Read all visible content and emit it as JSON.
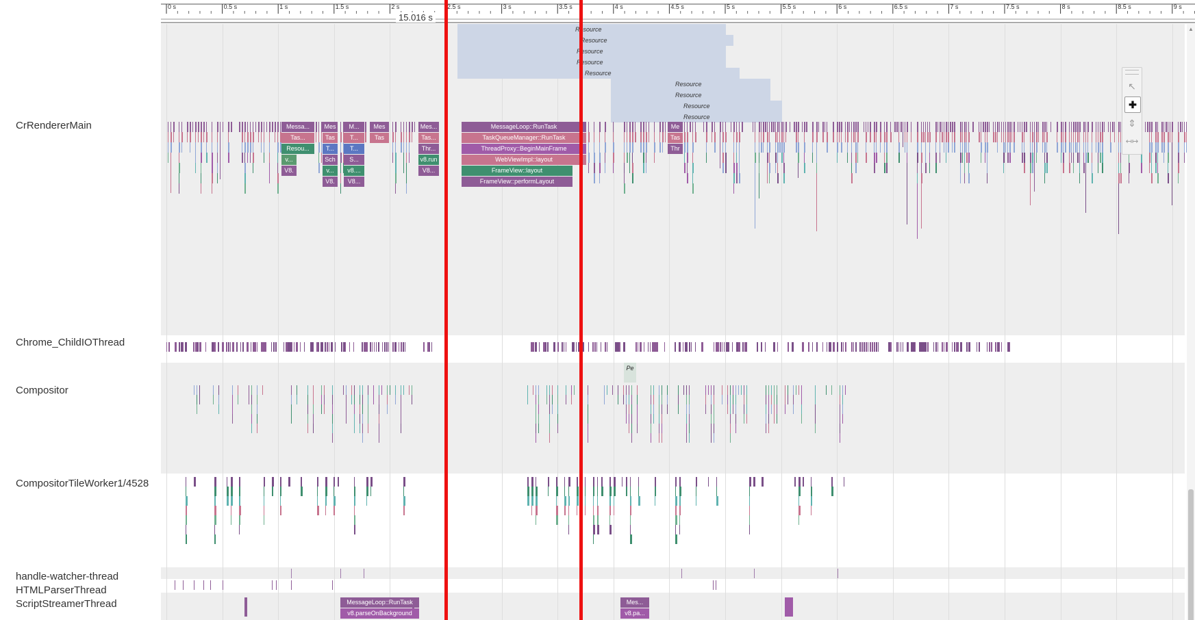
{
  "threads": [
    {
      "key": "renderer",
      "label": "CrRendererMain"
    },
    {
      "key": "childio",
      "label": "Chrome_ChildIOThread"
    },
    {
      "key": "compositor",
      "label": "Compositor"
    },
    {
      "key": "tileworker",
      "label": "CompositorTileWorker1/4528"
    },
    {
      "key": "handlewatcher",
      "label": "handle-watcher-thread"
    },
    {
      "key": "htmlparser",
      "label": "HTMLParserThread"
    },
    {
      "key": "scriptstreamer",
      "label": "ScriptStreamerThread"
    }
  ],
  "ruler": {
    "ticks": [
      "0 s",
      "0.5 s",
      "1 s",
      "1.5 s",
      "2 s",
      "2.5 s",
      "3 s",
      "3.5 s",
      "4 s",
      "4.5 s",
      "5 s",
      "5.5 s",
      "6 s",
      "6.5 s",
      "7 s",
      "7.5 s",
      "8 s",
      "8.5 s",
      "9 s"
    ],
    "selection_duration": "15.016 s"
  },
  "async_resources": [
    "Resource",
    "Resource",
    "Resource",
    "Resource",
    "Resource",
    "Resource",
    "Resource",
    "Resource",
    "Resource"
  ],
  "renderer_stack_main": [
    "MessageLoop::RunTask",
    "TaskQueueManager::RunTask",
    "ThreadProxy::BeginMainFrame",
    "WebViewImpl::layout",
    "FrameView::layout",
    "FrameView::performLayout"
  ],
  "renderer_stack_truncated": {
    "col1": [
      "Messa...",
      "Tas...",
      "Resou...",
      "v...",
      "V8."
    ],
    "col2": [
      "Mes",
      "Tas",
      "T...",
      "Sch",
      "v...",
      "V8."
    ],
    "col3": [
      "M...",
      "T...",
      "T...",
      "S...",
      "v8....",
      "V8..."
    ],
    "col4": [
      "Mes",
      "Tas"
    ],
    "col5": [
      "Mes...",
      "Tas...",
      "Thr...",
      "v8.run",
      "V8..."
    ],
    "col6": [
      "Me",
      "Tas",
      "Thr"
    ]
  },
  "compositor_label": "Pe",
  "scriptstreamer_slices": {
    "a": [
      "MessageLoop::RunTask",
      "v8.parseOnBackground"
    ],
    "b": [
      "Mes...",
      "v8.pa..."
    ]
  },
  "colors": {
    "selection_marker": "#ee1111",
    "track_alt_bg": "#eeeeee",
    "async_resource": "#cdd6e6",
    "slice_purple": "#8e5c96",
    "slice_pink": "#c7748e",
    "slice_green": "#3f8f6f",
    "slice_blue": "#8fa6d6"
  },
  "tools": {
    "items": [
      "select-icon",
      "pan-icon",
      "zoom-icon",
      "timing-icon"
    ],
    "active": "pan-icon"
  }
}
